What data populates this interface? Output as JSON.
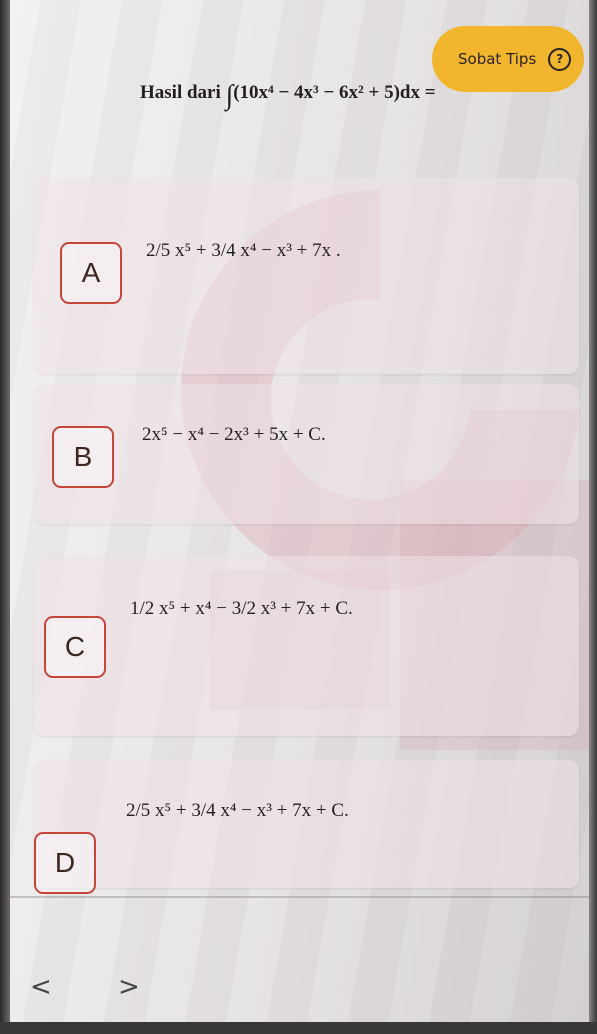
{
  "tips": {
    "label": "Sobat Tips",
    "icon": "help-circle-icon",
    "icon_glyph": "?"
  },
  "question": {
    "prefix": "Hasil dari",
    "integral_symbol": "∫",
    "expression": "(10x⁴ − 4x³ − 6x² + 5)dx ="
  },
  "options": [
    {
      "letter": "A",
      "text": "2/5 x⁵ + 3/4 x⁴ − x³ + 7x ."
    },
    {
      "letter": "B",
      "text": "2x⁵ − x⁴ − 2x³ + 5x + C."
    },
    {
      "letter": "C",
      "text": "1/2 x⁵ + x⁴ − 3/2 x³ + 7x + C."
    },
    {
      "letter": "D",
      "text": "2/5 x⁵ + 3/4 x⁴ − x³ + 7x + C."
    }
  ],
  "nav": {
    "prev": "<",
    "next": ">"
  },
  "colors": {
    "accent": "#f1b62e",
    "option_border": "#c8453b",
    "watermark": "#d9a0ac"
  }
}
